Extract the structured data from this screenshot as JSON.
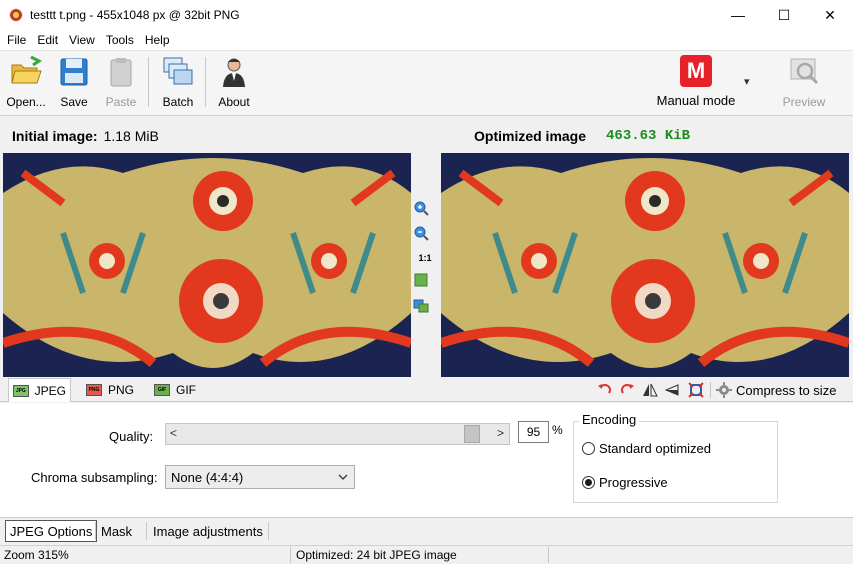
{
  "window": {
    "title": "testtt t.png - 455x1048 px @ 32bit PNG",
    "minimize": "—",
    "maximize": "☐",
    "close": "✕"
  },
  "menu": [
    "File",
    "Edit",
    "View",
    "Tools",
    "Help"
  ],
  "toolbar": {
    "open": "Open...",
    "save": "Save",
    "paste": "Paste",
    "batch": "Batch",
    "about": "About",
    "mode_letter": "M",
    "mode": "Manual mode",
    "mode_arrow": "▾",
    "preview": "Preview"
  },
  "images": {
    "initial_label": "Initial image:",
    "initial_size": "1.18 MiB",
    "optimized_label": "Optimized image",
    "optimized_size": "463.63 KiB",
    "zoom_ratio": "1:1"
  },
  "format_tabs": {
    "jpeg": "JPEG",
    "jpeg_icon": "JPG",
    "png": "PNG",
    "png_icon": "PNG",
    "gif": "GIF",
    "gif_icon": "GIF",
    "compress": "Compress to size"
  },
  "options": {
    "quality_label": "Quality:",
    "quality_value": "95",
    "quality_percent": "%",
    "quality_fraction": 0.95,
    "slider_left": "<",
    "slider_right": ">",
    "chroma_label": "Chroma subsampling:",
    "chroma_value": "None (4:4:4)",
    "encoding_label": "Encoding",
    "encoding_standard": "Standard optimized",
    "encoding_progressive": "Progressive"
  },
  "bottom_tabs": [
    "JPEG Options",
    "Mask",
    "Image adjustments"
  ],
  "status": {
    "zoom": "Zoom 315%",
    "info": "Optimized: 24 bit JPEG image"
  },
  "colors": {
    "mode_red": "#e8202a",
    "optimized_green": "#1d8a1d",
    "rug_blue": "#1b2450",
    "rug_yellow": "#c9b66a",
    "rug_red": "#e2391e"
  }
}
